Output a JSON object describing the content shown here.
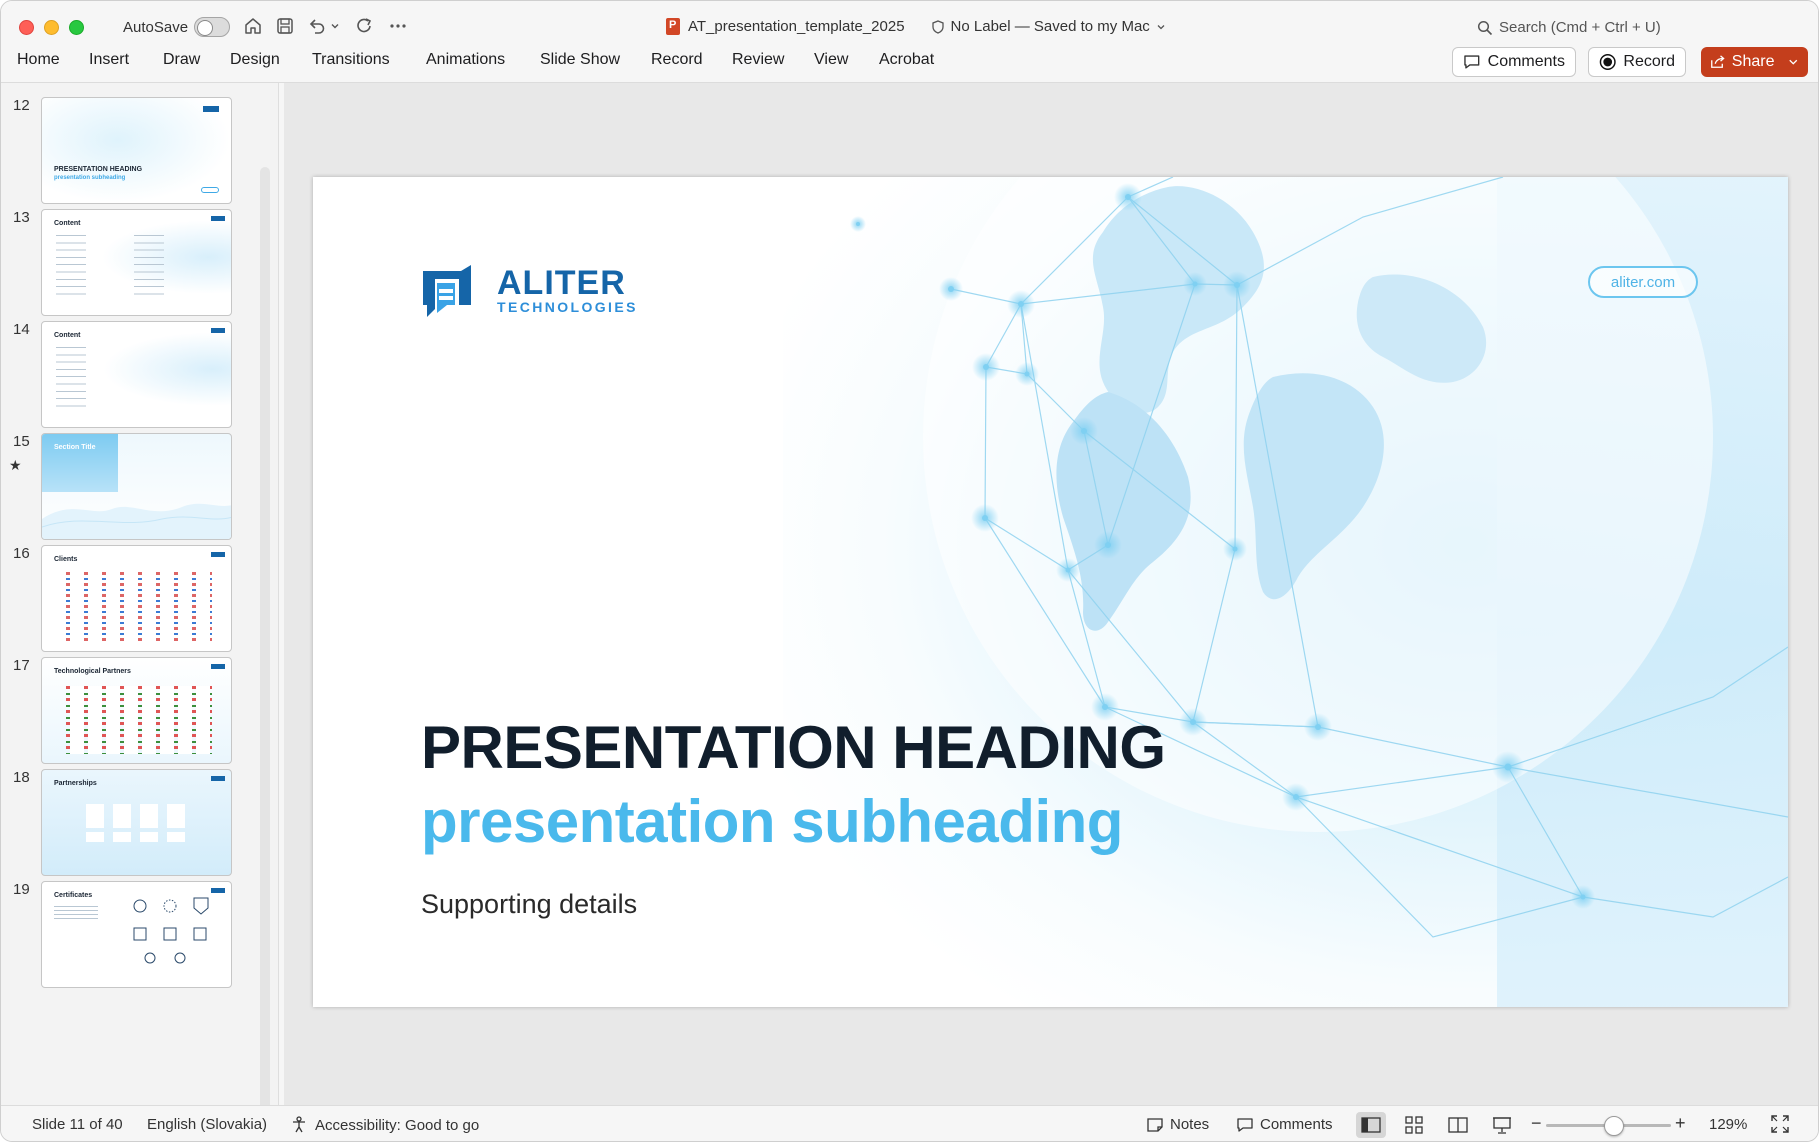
{
  "window": {
    "autosave_label": "AutoSave",
    "doc_title": "AT_presentation_template_2025",
    "label_status": "No Label — Saved to my Mac",
    "search_placeholder": "Search (Cmd + Ctrl + U)"
  },
  "ribbon": {
    "tabs": [
      "Home",
      "Insert",
      "Draw",
      "Design",
      "Transitions",
      "Animations",
      "Slide Show",
      "Record",
      "Review",
      "View",
      "Acrobat"
    ],
    "comments_label": "Comments",
    "record_label": "Record",
    "share_label": "Share"
  },
  "thumbnails": [
    {
      "num": "12",
      "title": "PRESENTATION HEADING",
      "sub": "presentation subheading"
    },
    {
      "num": "13",
      "title": "Content",
      "sub": ""
    },
    {
      "num": "14",
      "title": "Content",
      "sub": ""
    },
    {
      "num": "15",
      "title": "Section Title",
      "sub": ""
    },
    {
      "num": "16",
      "title": "Clients",
      "sub": ""
    },
    {
      "num": "17",
      "title": "Technological Partners",
      "sub": ""
    },
    {
      "num": "18",
      "title": "Partnerships",
      "sub": ""
    },
    {
      "num": "19",
      "title": "Certificates",
      "sub": ""
    }
  ],
  "slide": {
    "logo_line1": "ALITER",
    "logo_line2": "TECHNOLOGIES",
    "url": "aliter.com",
    "heading": "PRESENTATION HEADING",
    "subheading": "presentation subheading",
    "supporting": "Supporting details"
  },
  "status": {
    "slide_info": "Slide 11 of 40",
    "language": "English (Slovakia)",
    "accessibility": "Accessibility: Good to go",
    "notes": "Notes",
    "comments": "Comments",
    "zoom": "129%"
  },
  "colors": {
    "share": "#c43e1c",
    "heading": "#111e2c",
    "subheading": "#4ab9ec",
    "logo": "#1565a8"
  }
}
